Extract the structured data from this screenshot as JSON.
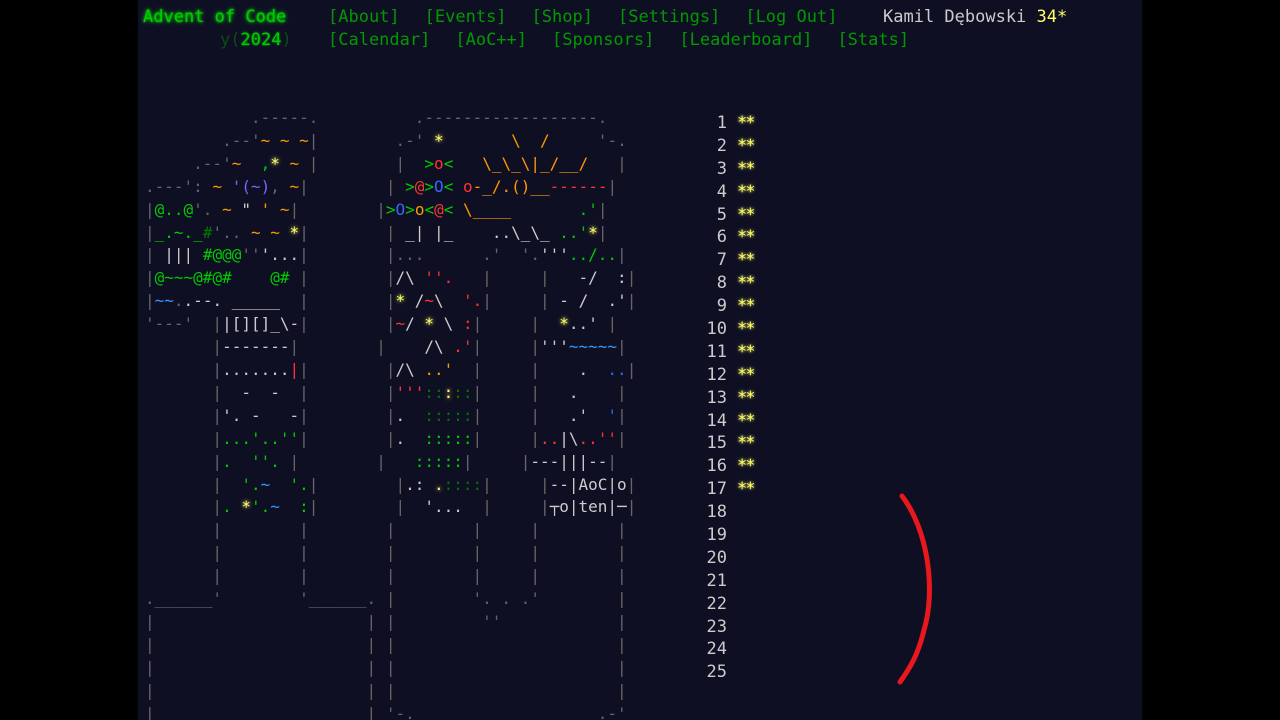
{
  "header": {
    "title": "Advent of Code",
    "year_prefix": "y(",
    "year": "2024",
    "year_suffix": ")",
    "nav_row1": [
      "[About]",
      "[Events]",
      "[Shop]",
      "[Settings]",
      "[Log Out]"
    ],
    "nav_row2": [
      "[Calendar]",
      "[AoC++]",
      "[Sponsors]",
      "[Leaderboard]",
      "[Stats]"
    ],
    "user_name": "Kamil Dębowski",
    "user_stars": "34*"
  },
  "calendar": {
    "days": [
      {
        "num": "1",
        "stars": "**"
      },
      {
        "num": "2",
        "stars": "**"
      },
      {
        "num": "3",
        "stars": "**"
      },
      {
        "num": "4",
        "stars": "**"
      },
      {
        "num": "5",
        "stars": "**"
      },
      {
        "num": "6",
        "stars": "**"
      },
      {
        "num": "7",
        "stars": "**"
      },
      {
        "num": "8",
        "stars": "**"
      },
      {
        "num": "9",
        "stars": "**"
      },
      {
        "num": "10",
        "stars": "**"
      },
      {
        "num": "11",
        "stars": "**"
      },
      {
        "num": "12",
        "stars": "**"
      },
      {
        "num": "13",
        "stars": "**"
      },
      {
        "num": "14",
        "stars": "**"
      },
      {
        "num": "15",
        "stars": "**"
      },
      {
        "num": "16",
        "stars": "**"
      },
      {
        "num": "17",
        "stars": "**"
      },
      {
        "num": "18",
        "stars": ""
      },
      {
        "num": "19",
        "stars": ""
      },
      {
        "num": "20",
        "stars": ""
      },
      {
        "num": "21",
        "stars": ""
      },
      {
        "num": "22",
        "stars": ""
      },
      {
        "num": "23",
        "stars": ""
      },
      {
        "num": "24",
        "stars": ""
      },
      {
        "num": "25",
        "stars": ""
      }
    ]
  },
  "colors": {
    "background": "#0f0f23",
    "link": "#009900",
    "title": "#00cc00",
    "star": "#ffff66",
    "annotation": "#e8181c"
  }
}
